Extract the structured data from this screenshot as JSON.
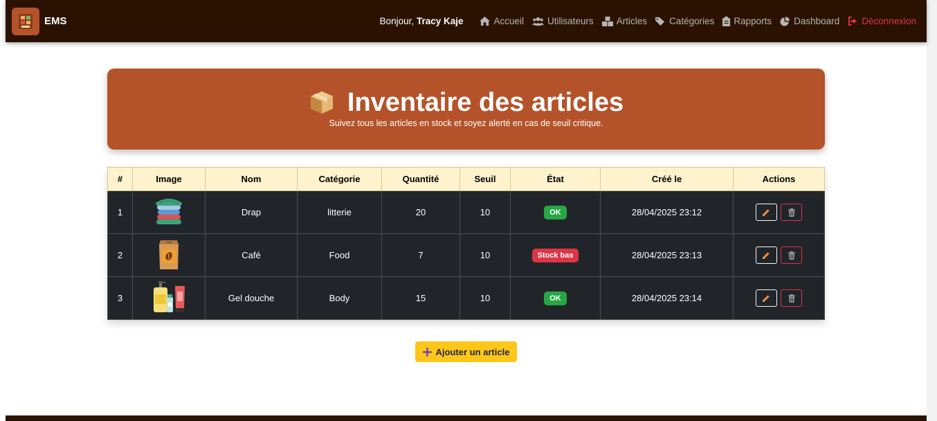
{
  "navbar": {
    "brand": "EMS",
    "greeting_prefix": "Bonjour,",
    "user_name": "Tracy Kaje",
    "links": [
      {
        "label": "Accueil",
        "icon": "home-icon"
      },
      {
        "label": "Utilisateurs",
        "icon": "users-icon"
      },
      {
        "label": "Articles",
        "icon": "boxes-icon"
      },
      {
        "label": "Catégories",
        "icon": "tags-icon"
      },
      {
        "label": "Rapports",
        "icon": "clipboard-icon"
      },
      {
        "label": "Dashboard",
        "icon": "pie-chart-icon"
      },
      {
        "label": "Déconnexion",
        "icon": "logout-icon"
      }
    ]
  },
  "hero": {
    "title": "Inventaire des articles",
    "subtitle": "Suivez tous les articles en stock et soyez alerté en cas de seuil critique."
  },
  "table": {
    "headers": [
      "#",
      "Image",
      "Nom",
      "Catégorie",
      "Quantité",
      "Seuil",
      "État",
      "Créé le",
      "Actions"
    ],
    "rows": [
      {
        "num": "1",
        "image": "folded-sheets-image",
        "name": "Drap",
        "category": "litterie",
        "qty": "20",
        "threshold": "10",
        "status": "OK",
        "status_type": "ok",
        "created": "28/04/2025 23:12"
      },
      {
        "num": "2",
        "image": "coffee-bag-image",
        "name": "Café",
        "category": "Food",
        "qty": "7",
        "threshold": "10",
        "status": "Stock bas",
        "status_type": "low",
        "created": "28/04/2025 23:13"
      },
      {
        "num": "3",
        "image": "shower-gel-bottles-image",
        "name": "Gel douche",
        "category": "Body",
        "qty": "15",
        "threshold": "10",
        "status": "OK",
        "status_type": "ok",
        "created": "28/04/2025 23:14"
      }
    ]
  },
  "add_button": {
    "label": "Ajouter un article",
    "icon": "plus-icon"
  },
  "colors": {
    "navbar_bg": "#2b1200",
    "hero_bg": "#b4532a",
    "header_bg": "#fff3cd",
    "row_bg": "#212529",
    "ok": "#28a745",
    "low": "#dc3545",
    "add_btn": "#ffc61a"
  }
}
